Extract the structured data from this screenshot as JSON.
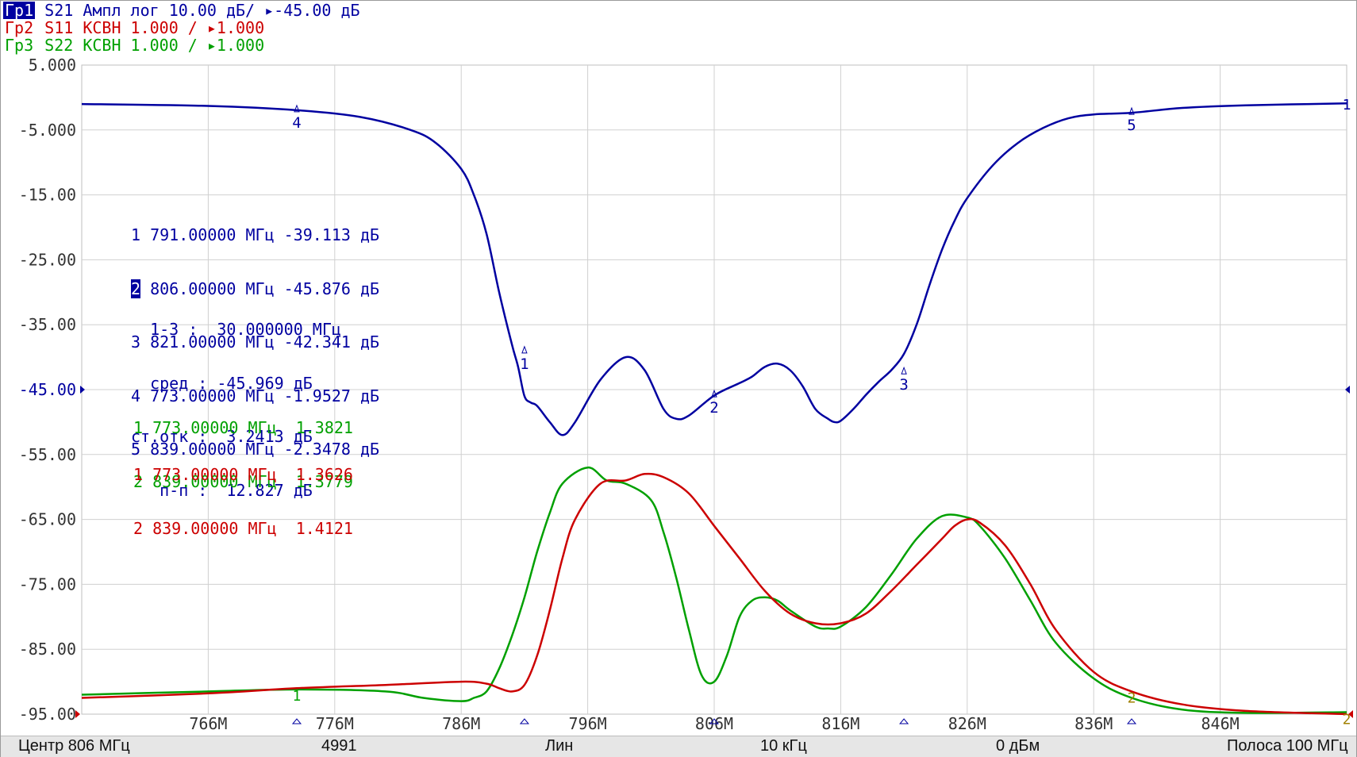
{
  "traces": [
    {
      "tag": "Гр1",
      "text": " S21 Ампл лог 10.00 дБ/ ▸-45.00 дБ",
      "color": "#0000a0"
    },
    {
      "tag": "Гр2",
      "text": " S11 КСВН 1.000 / ▸1.000",
      "color": "#cc0000"
    },
    {
      "tag": "Гр3",
      "text": " S22 КСВН 1.000 / ▸1.000",
      "color": "#00a000"
    }
  ],
  "markers_s21": [
    {
      "label": "1 791.00000 МГц -39.113 дБ",
      "selected": false
    },
    {
      "num": "2",
      "label": " 806.00000 МГц -45.876 дБ",
      "selected": true
    },
    {
      "label": "3 821.00000 МГц -42.341 дБ",
      "selected": false
    },
    {
      "label": "4 773.00000 МГц -1.9527 дБ",
      "selected": false
    },
    {
      "label": "5 839.00000 МГц -2.3478 дБ",
      "selected": false
    }
  ],
  "stats": [
    "  1-3 :  30.000000 МГц",
    "  сред : -45.969 дБ",
    "ст.отк :  3.2413 дБ",
    "   п-п :  12.827 дБ"
  ],
  "markers_s22": [
    "1 773.00000 МГц  1.3821",
    "2 839.00000 МГц  1.3779"
  ],
  "markers_s11": [
    "1 773.00000 МГц  1.3626",
    "2 839.00000 МГц  1.4121"
  ],
  "status": {
    "center": "Центр 806 МГц",
    "points": "4991",
    "sweep": "Лин",
    "ifbw": "10 кГц",
    "power": "0 дБм",
    "span": "Полоса 100 МГц"
  },
  "chart_data": {
    "type": "line",
    "x_unit": "MHz",
    "xlim": [
      756,
      856
    ],
    "ylim": [
      -95,
      5
    ],
    "y_ticks": [
      "5.000",
      "-5.000",
      "-15.00",
      "-25.00",
      "-35.00",
      "-45.00",
      "-55.00",
      "-65.00",
      "-75.00",
      "-85.00",
      "-95.00"
    ],
    "x_ticks": [
      "766M",
      "776M",
      "786M",
      "796M",
      "806M",
      "816M",
      "826M",
      "836M",
      "846M"
    ],
    "grid": true,
    "series": [
      {
        "name": "S21",
        "color": "#0000a0",
        "x": [
          756,
          766,
          773,
          778,
          782,
          784,
          786,
          787,
          788,
          789,
          790,
          790.5,
          791,
          791.5,
          792,
          793,
          794,
          795,
          797,
          799,
          800.5,
          802,
          803,
          804,
          806,
          808,
          809,
          810,
          811,
          812,
          813,
          814,
          815,
          815.5,
          816,
          817,
          818,
          819,
          820,
          821,
          822,
          823,
          824,
          825,
          826,
          828,
          830,
          832,
          834,
          836,
          839,
          843,
          848,
          856
        ],
        "y": [
          -1.0,
          -1.3,
          -1.95,
          -3.0,
          -5.0,
          -7.0,
          -11.0,
          -15.0,
          -21.0,
          -30.0,
          -38.0,
          -41.5,
          -46.0,
          -47.0,
          -47.5,
          -50.0,
          -52.0,
          -50.0,
          -43.5,
          -40.0,
          -42.0,
          -48.0,
          -49.5,
          -49.0,
          -45.9,
          -44.0,
          -43.0,
          -41.5,
          -41.0,
          -42.0,
          -44.5,
          -48.0,
          -49.5,
          -50.0,
          -49.8,
          -48.0,
          -45.8,
          -43.8,
          -42.0,
          -39.5,
          -35.0,
          -29.0,
          -23.5,
          -19.0,
          -15.5,
          -10.5,
          -7.0,
          -4.7,
          -3.2,
          -2.6,
          -2.35,
          -1.6,
          -1.2,
          -0.9
        ]
      },
      {
        "name": "S11",
        "color": "#cc0000",
        "x": [
          756,
          766,
          773,
          780,
          786,
          788,
          789,
          790,
          791,
          792,
          793,
          794,
          795,
          797,
          799,
          800.5,
          802,
          804,
          806,
          808,
          810,
          812,
          814,
          816,
          818,
          820,
          822,
          824,
          825,
          826,
          827,
          829,
          831,
          833,
          836,
          839,
          843,
          848,
          856
        ],
        "y": [
          -92.5,
          -91.8,
          -91.0,
          -90.5,
          -90.0,
          -90.3,
          -91.0,
          -91.5,
          -90.5,
          -86.0,
          -79.0,
          -71.0,
          -65.0,
          -59.5,
          -59.0,
          -58.0,
          -58.5,
          -61.0,
          -66.0,
          -71.0,
          -76.0,
          -79.5,
          -81.0,
          -81.0,
          -79.5,
          -76.0,
          -72.0,
          -68.0,
          -66.0,
          -65.0,
          -65.5,
          -69.0,
          -75.0,
          -82.0,
          -88.5,
          -91.5,
          -93.5,
          -94.5,
          -95.0
        ]
      },
      {
        "name": "S22",
        "color": "#00a000",
        "x": [
          756,
          766,
          773,
          780,
          783,
          786,
          787,
          788,
          789,
          790,
          791,
          792,
          793,
          794,
          796,
          797.5,
          799,
          801,
          802,
          803,
          804,
          805,
          806,
          807,
          808,
          809,
          810,
          811,
          812,
          814,
          815,
          816,
          818,
          820,
          822,
          824,
          826,
          827,
          829,
          831,
          833,
          836,
          839,
          843,
          848,
          856
        ],
        "y": [
          -92.0,
          -91.5,
          -91.2,
          -91.5,
          -92.5,
          -93.0,
          -92.5,
          -91.5,
          -88.0,
          -83.0,
          -77.0,
          -70.0,
          -64.0,
          -59.5,
          -57.0,
          -59.0,
          -59.5,
          -62.0,
          -67.0,
          -74.0,
          -82.0,
          -89.0,
          -90.0,
          -86.0,
          -80.0,
          -77.5,
          -77.0,
          -77.5,
          -79.0,
          -81.5,
          -81.8,
          -81.5,
          -78.5,
          -73.5,
          -68.0,
          -64.5,
          -64.7,
          -66.0,
          -71.0,
          -77.5,
          -84.0,
          -89.5,
          -92.5,
          -94.3,
          -94.8,
          -94.7
        ]
      }
    ],
    "marker_tags_s21": [
      {
        "label": "1",
        "x": 791,
        "y": -39.113
      },
      {
        "label": "2",
        "x": 806,
        "y": -45.876
      },
      {
        "label": "3",
        "x": 821,
        "y": -42.341
      },
      {
        "label": "4",
        "x": 773,
        "y": -1.9527
      },
      {
        "label": "5",
        "x": 839,
        "y": -2.3478
      }
    ],
    "edge_labels": [
      {
        "label": "1",
        "x": 856,
        "y": -1.0
      },
      {
        "label": "1",
        "x": 773,
        "y": -91.2
      },
      {
        "label": "2",
        "x": 839,
        "y": -91.5
      },
      {
        "label": "2",
        "x": 856,
        "y": -94.8
      }
    ]
  }
}
